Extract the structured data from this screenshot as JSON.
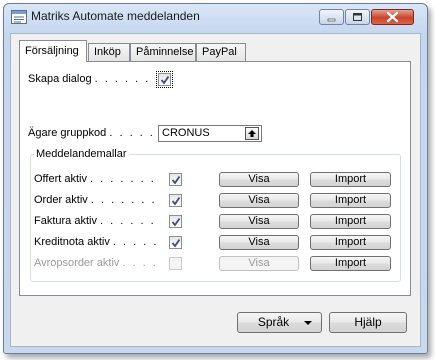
{
  "window": {
    "title": "Matriks Automate meddelanden",
    "icon": "form-icon"
  },
  "tabs": [
    {
      "label": "Försäljning",
      "active": true
    },
    {
      "label": "Inköp",
      "active": false
    },
    {
      "label": "Påminnelse",
      "active": false
    },
    {
      "label": "PayPal",
      "active": false
    }
  ],
  "fields": {
    "skapa_dialog": {
      "label": "Skapa dialog",
      "dots": ". . . . . .",
      "checked": true
    },
    "agare_gruppkod": {
      "label": "Ägare gruppkod",
      "dots": ". . . . .",
      "value": "CRONUS",
      "button_icon": "assist-edit-icon"
    }
  },
  "group": {
    "title": "Meddelandemallar",
    "rows": [
      {
        "label": "Offert aktiv",
        "dots": ". . . . . . .",
        "checked": true,
        "enabled": true,
        "visa": "Visa",
        "import": "Import"
      },
      {
        "label": "Order aktiv",
        "dots": ". . . . . . .",
        "checked": true,
        "enabled": true,
        "visa": "Visa",
        "import": "Import"
      },
      {
        "label": "Faktura aktiv",
        "dots": ". . . . . .",
        "checked": true,
        "enabled": true,
        "visa": "Visa",
        "import": "Import"
      },
      {
        "label": "Kreditnota aktiv",
        "dots": ". . . . .",
        "checked": true,
        "enabled": true,
        "visa": "Visa",
        "import": "Import"
      },
      {
        "label": "Avropsorder aktiv",
        "dots": ". . . .",
        "checked": false,
        "enabled": false,
        "visa": "Visa",
        "import": "Import"
      }
    ]
  },
  "footer": {
    "language_button": "Språk",
    "help_button": "Hjälp"
  }
}
